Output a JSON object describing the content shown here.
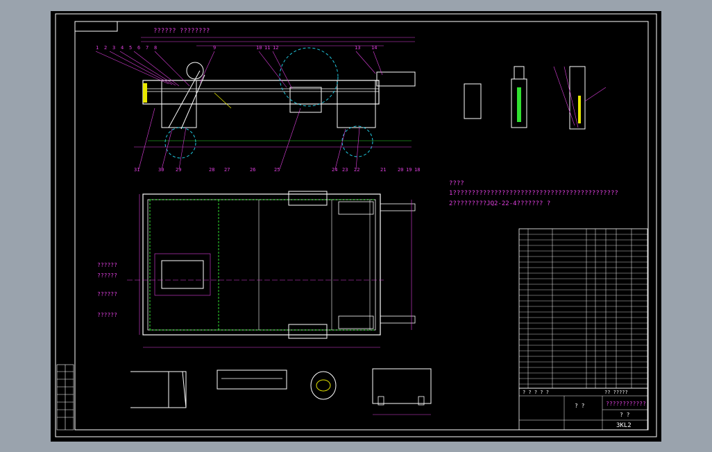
{
  "colors": {
    "outer": "#9aa3ad",
    "sheet": "#000000",
    "white": "#ffffff",
    "magenta": "#e040e0",
    "green": "#30e030",
    "yellow": "#e8e800",
    "cyan": "#20c8e0"
  },
  "header_label": "?????? ????????",
  "notes": {
    "title": "????",
    "line1": "1????????????????????????????????????????????",
    "line2": "2?????????JQ2-22-4??????? ?"
  },
  "left_labels": [
    "??????",
    "??????",
    "??????",
    "??????"
  ],
  "top_callouts": [
    "1",
    "2",
    "3",
    "4",
    "5",
    "6",
    "7",
    "8",
    "9",
    "10",
    "11",
    "12",
    "13",
    "14"
  ],
  "bottom_callouts": [
    "31",
    "30",
    "29",
    "28",
    "27",
    "26",
    "25",
    "24",
    "23",
    "22",
    "21",
    "20",
    "19",
    "18"
  ],
  "title_block": {
    "drawing_no": "3KL2",
    "name_cell": "????????????",
    "scale_cell": "? ?",
    "unit_cell": "? ?",
    "row_labels": "? ? ? ? ?",
    "material_cell": "?? ?????"
  },
  "icons": {
    "dimension": "dimension-line-icon",
    "leader": "leader-line-icon"
  }
}
